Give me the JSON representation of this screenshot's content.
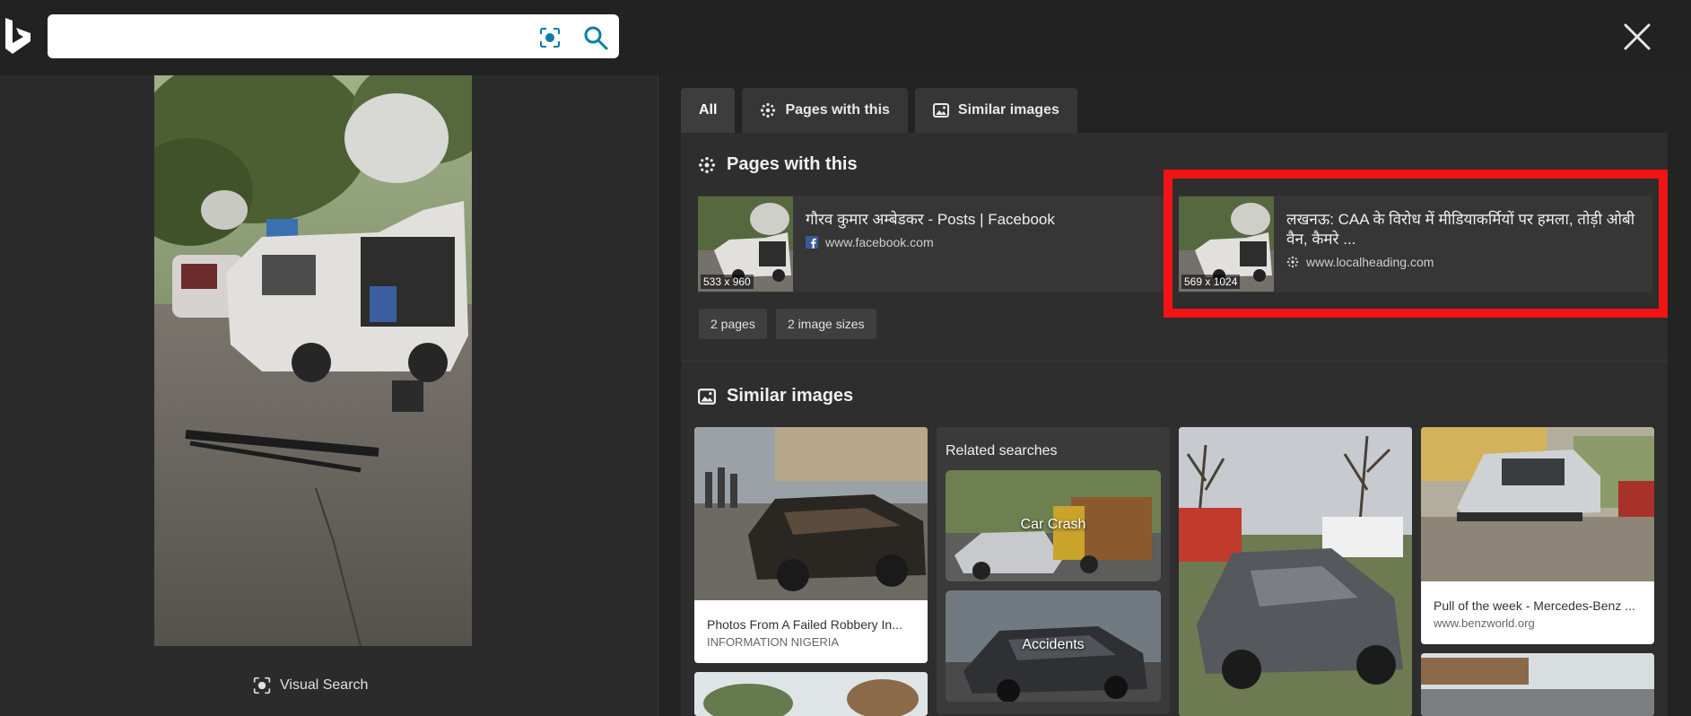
{
  "search": {
    "value": "",
    "placeholder": ""
  },
  "visual_search_label": "Visual Search",
  "tabs": [
    {
      "label": "All"
    },
    {
      "label": "Pages with this"
    },
    {
      "label": "Similar images"
    }
  ],
  "pages_with_this": {
    "title": "Pages with this",
    "cards": [
      {
        "title": "गौरव कुमार अम्बेडकर - Posts | Facebook",
        "source": "www.facebook.com",
        "size": "533 x 960"
      },
      {
        "title": "लखनऊ: CAA के विरोध में मीडियाकर्मियों पर हमला, तोड़ी ओबी वैन, कैमरे ...",
        "source": "www.localheading.com",
        "size": "569 x 1024"
      }
    ],
    "chips": [
      "2 pages",
      "2 image sizes"
    ]
  },
  "similar_images": {
    "title": "Similar images",
    "cards": [
      {
        "title": "Photos From A Failed Robbery In...",
        "source": "INFORMATION NIGERIA"
      },
      {
        "title": "Pull of the week - Mercedes-Benz ...",
        "source": "www.benzworld.org"
      }
    ],
    "related": {
      "title": "Related searches",
      "items": [
        {
          "label": "Car Crash"
        },
        {
          "label": "Accidents"
        }
      ]
    }
  },
  "colors": {
    "highlight": "#f01414",
    "accent": "#0a7ea4"
  }
}
